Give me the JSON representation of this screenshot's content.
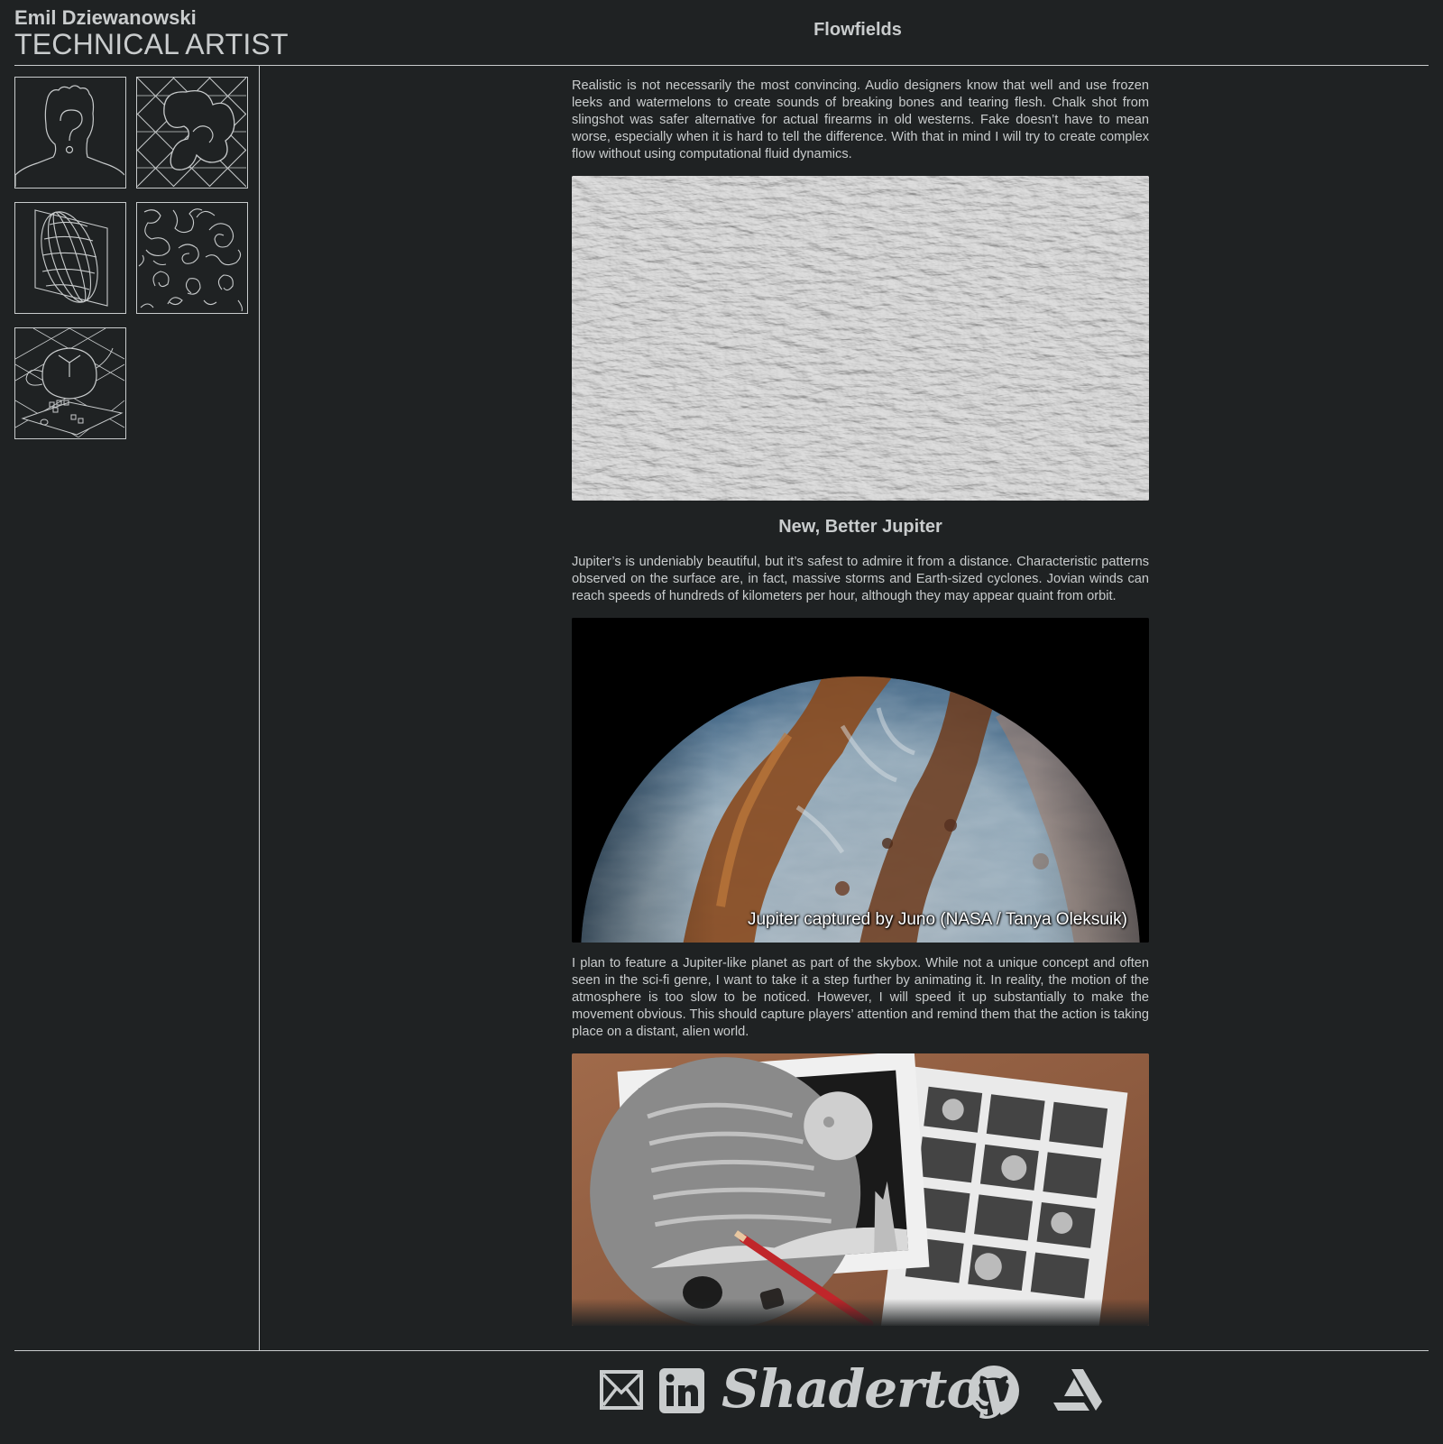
{
  "header": {
    "name": "Emil Dziewanowski",
    "role": "TECHNICAL ARTIST",
    "title": "Flowfields"
  },
  "sidebar": {
    "thumbnails": [
      {
        "icon": "profile-silhouette-icon"
      },
      {
        "icon": "blob-sculpture-icon"
      },
      {
        "icon": "wireframe-sphere-icon"
      },
      {
        "icon": "swirl-pattern-icon"
      },
      {
        "icon": "teapot-scene-icon"
      }
    ]
  },
  "content": {
    "intro": "Realistic is not necessarily the most convincing. Audio designers know that well and use frozen leeks and watermelons to create sounds of breaking bones and tearing flesh. Chalk shot from slingshot was safer alternative for actual firearms in old westerns. Fake doesn’t have to mean worse, especially when it is hard to tell the difference. With that in mind I will try to create complex flow without using computational fluid dynamics.",
    "section_title": "New, Better Jupiter",
    "section_para1": "Jupiter’s is undeniably beautiful, but it’s safest to admire it from a distance. Characteristic patterns observed on the surface are, in fact, massive storms and Earth-sized cyclones. Jovian winds can reach speeds of hundreds of kilometers per hour, although they may appear quaint from orbit.",
    "jupiter_caption": "Jupiter captured by Juno (NASA / Tanya Oleksuik)",
    "section_para2": "I plan to feature a Jupiter-like planet as part of the skybox. While not a unique concept and often seen in the sci-fi genre, I want to take it a step further by animating it. In reality, the motion of the atmosphere is too slow to be noticed. However, I will speed it up substantially to make the movement obvious. This should capture players’ attention and remind them that the action is taking place on a distant, alien world."
  },
  "footer": {
    "links": [
      {
        "icon": "mail-icon"
      },
      {
        "icon": "linkedin-icon"
      },
      {
        "label": "Shadertoy"
      },
      {
        "icon": "github-icon"
      },
      {
        "icon": "artstation-icon"
      }
    ]
  },
  "colors": {
    "background": "#1f2223",
    "foreground": "#c9cccd",
    "rule": "#c8cbcc"
  }
}
